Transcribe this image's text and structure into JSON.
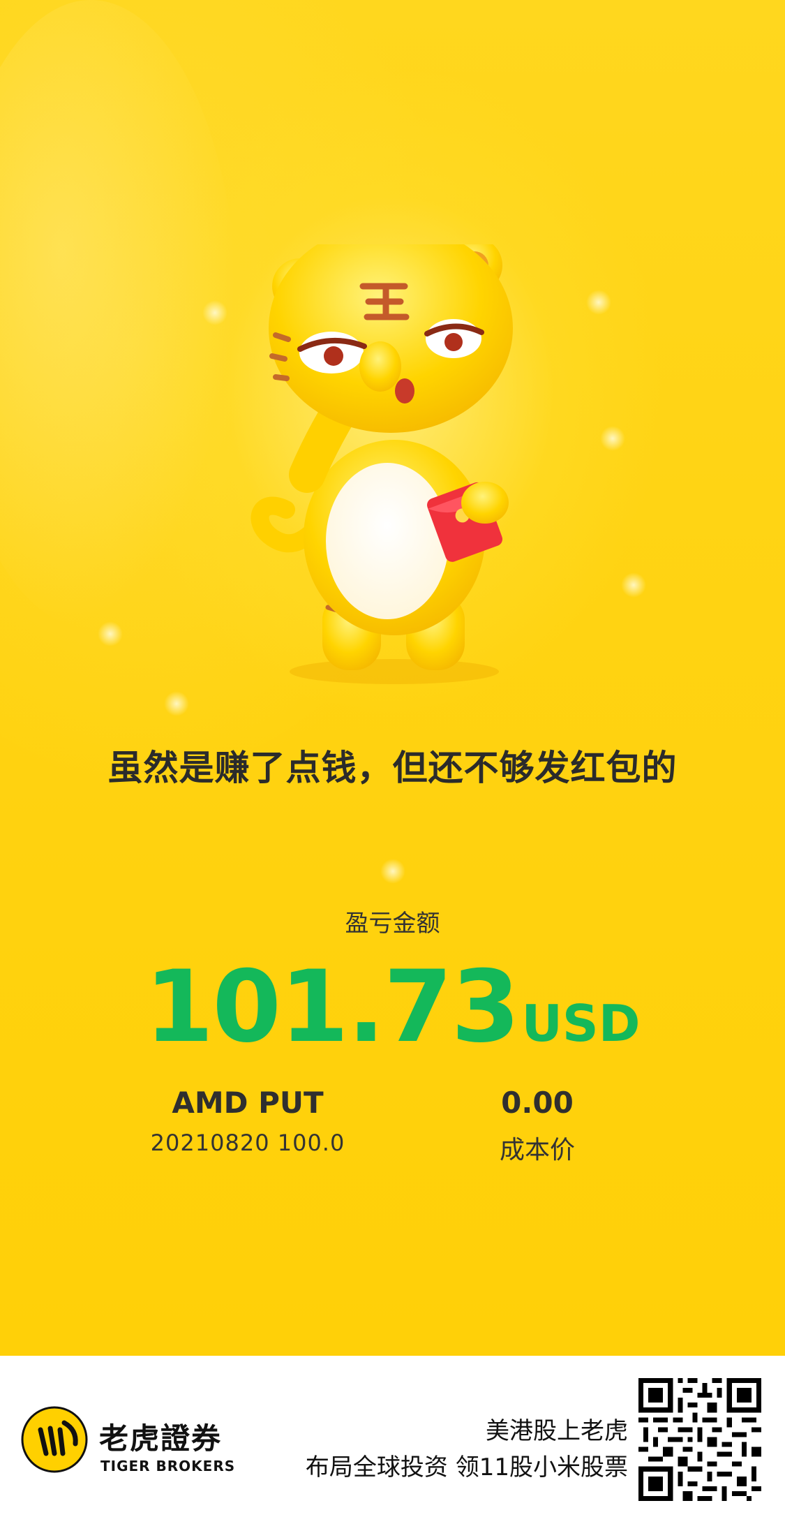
{
  "headline": "虽然是赚了点钱，但还不够发红包的",
  "pnl": {
    "label": "盈亏金额",
    "value": "101.73",
    "unit": "USD",
    "color": "#14b85a"
  },
  "contract": {
    "name": "AMD PUT",
    "detail": "20210820  100.0"
  },
  "cost": {
    "value": "0.00",
    "label": "成本价"
  },
  "footer": {
    "brand_cn": "老虎證券",
    "brand_en": "TIGER BROKERS",
    "slogan_line1": "美港股上老虎",
    "slogan_line2": "布局全球投资 领11股小米股票",
    "logo_icon": "tiger-logo-icon",
    "qr_icon": "qr-code-icon"
  },
  "colors": {
    "background": "#ffd21a",
    "mascot": "#ffd200",
    "footer_bg": "#ffffff"
  }
}
